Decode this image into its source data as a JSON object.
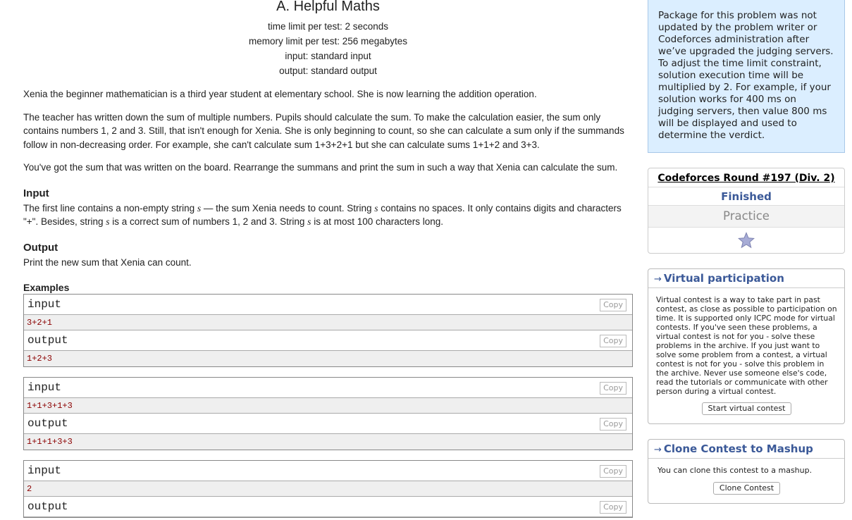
{
  "problem": {
    "title": "A. Helpful Maths",
    "limits": [
      "time limit per test: 2 seconds",
      "memory limit per test: 256 megabytes",
      "input: standard input",
      "output: standard output"
    ],
    "legend_p1": "Xenia the beginner mathematician is a third year student at elementary school. She is now learning the addition operation.",
    "legend_p2": "The teacher has written down the sum of multiple numbers. Pupils should calculate the sum. To make the calculation easier, the sum only contains numbers 1, 2 and 3. Still, that isn't enough for Xenia. She is only beginning to count, so she can calculate a sum only if the summands follow in non-decreasing order. For example, she can't calculate sum 1+3+2+1 but she can calculate sums 1+1+2 and 3+3.",
    "legend_p3": "You've got the sum that was written on the board. Rearrange the summans and print the sum in such a way that Xenia can calculate the sum.",
    "input_title": "Input",
    "input_spec": {
      "t1": "The first line contains a non-empty string ",
      "v1": "s",
      "t2": " — the sum Xenia needs to count. String ",
      "v2": "s",
      "t3": " contains no spaces. It only contains digits and characters \"+\". Besides, string ",
      "v3": "s",
      "t4": " is a correct sum of numbers 1, 2 and 3. String ",
      "v4": "s",
      "t5": " is at most 100 characters long."
    },
    "output_title": "Output",
    "output_spec": "Print the new sum that Xenia can count.",
    "examples_title": "Examples",
    "input_label": "input",
    "output_label": "output",
    "copy_label": "Copy",
    "examples": [
      {
        "input": "3+2+1",
        "output": "1+2+3"
      },
      {
        "input": "1+1+3+1+3",
        "output": "1+1+1+3+3"
      },
      {
        "input": "2",
        "output": ""
      }
    ]
  },
  "sidebar": {
    "notice": "Package for this problem was not updated by the problem writer or Codeforces administration after we’ve upgraded the judging servers. To adjust the time limit constraint, solution execution time will be multiplied by 2. For example, if your solution works for 400 ms on judging servers, then value 800 ms will be displayed and used to determine the verdict.",
    "round": {
      "name": "Codeforces Round #197 (Div. 2)",
      "status": "Finished",
      "practice": "Practice",
      "star_icon": "star-icon"
    },
    "virtual": {
      "arrow": "→",
      "title": "Virtual participation",
      "text": "Virtual contest is a way to take part in past contest, as close as possible to participation on time. It is supported only ICPC mode for virtual contests. If you've seen these problems, a virtual contest is not for you - solve these problems in the archive. If you just want to solve some problem from a contest, a virtual contest is not for you - solve this problem in the archive. Never use someone else's code, read the tutorials or communicate with other person during a virtual contest.",
      "button": "Start virtual contest"
    },
    "clone": {
      "arrow": "→",
      "title": "Clone Contest to Mashup",
      "text": "You can clone this contest to a mashup.",
      "button": "Clone Contest"
    }
  },
  "colors": {
    "notice_bg": "#dbeeff",
    "link_blue": "#3b5998",
    "example_text": "#8b0000"
  }
}
